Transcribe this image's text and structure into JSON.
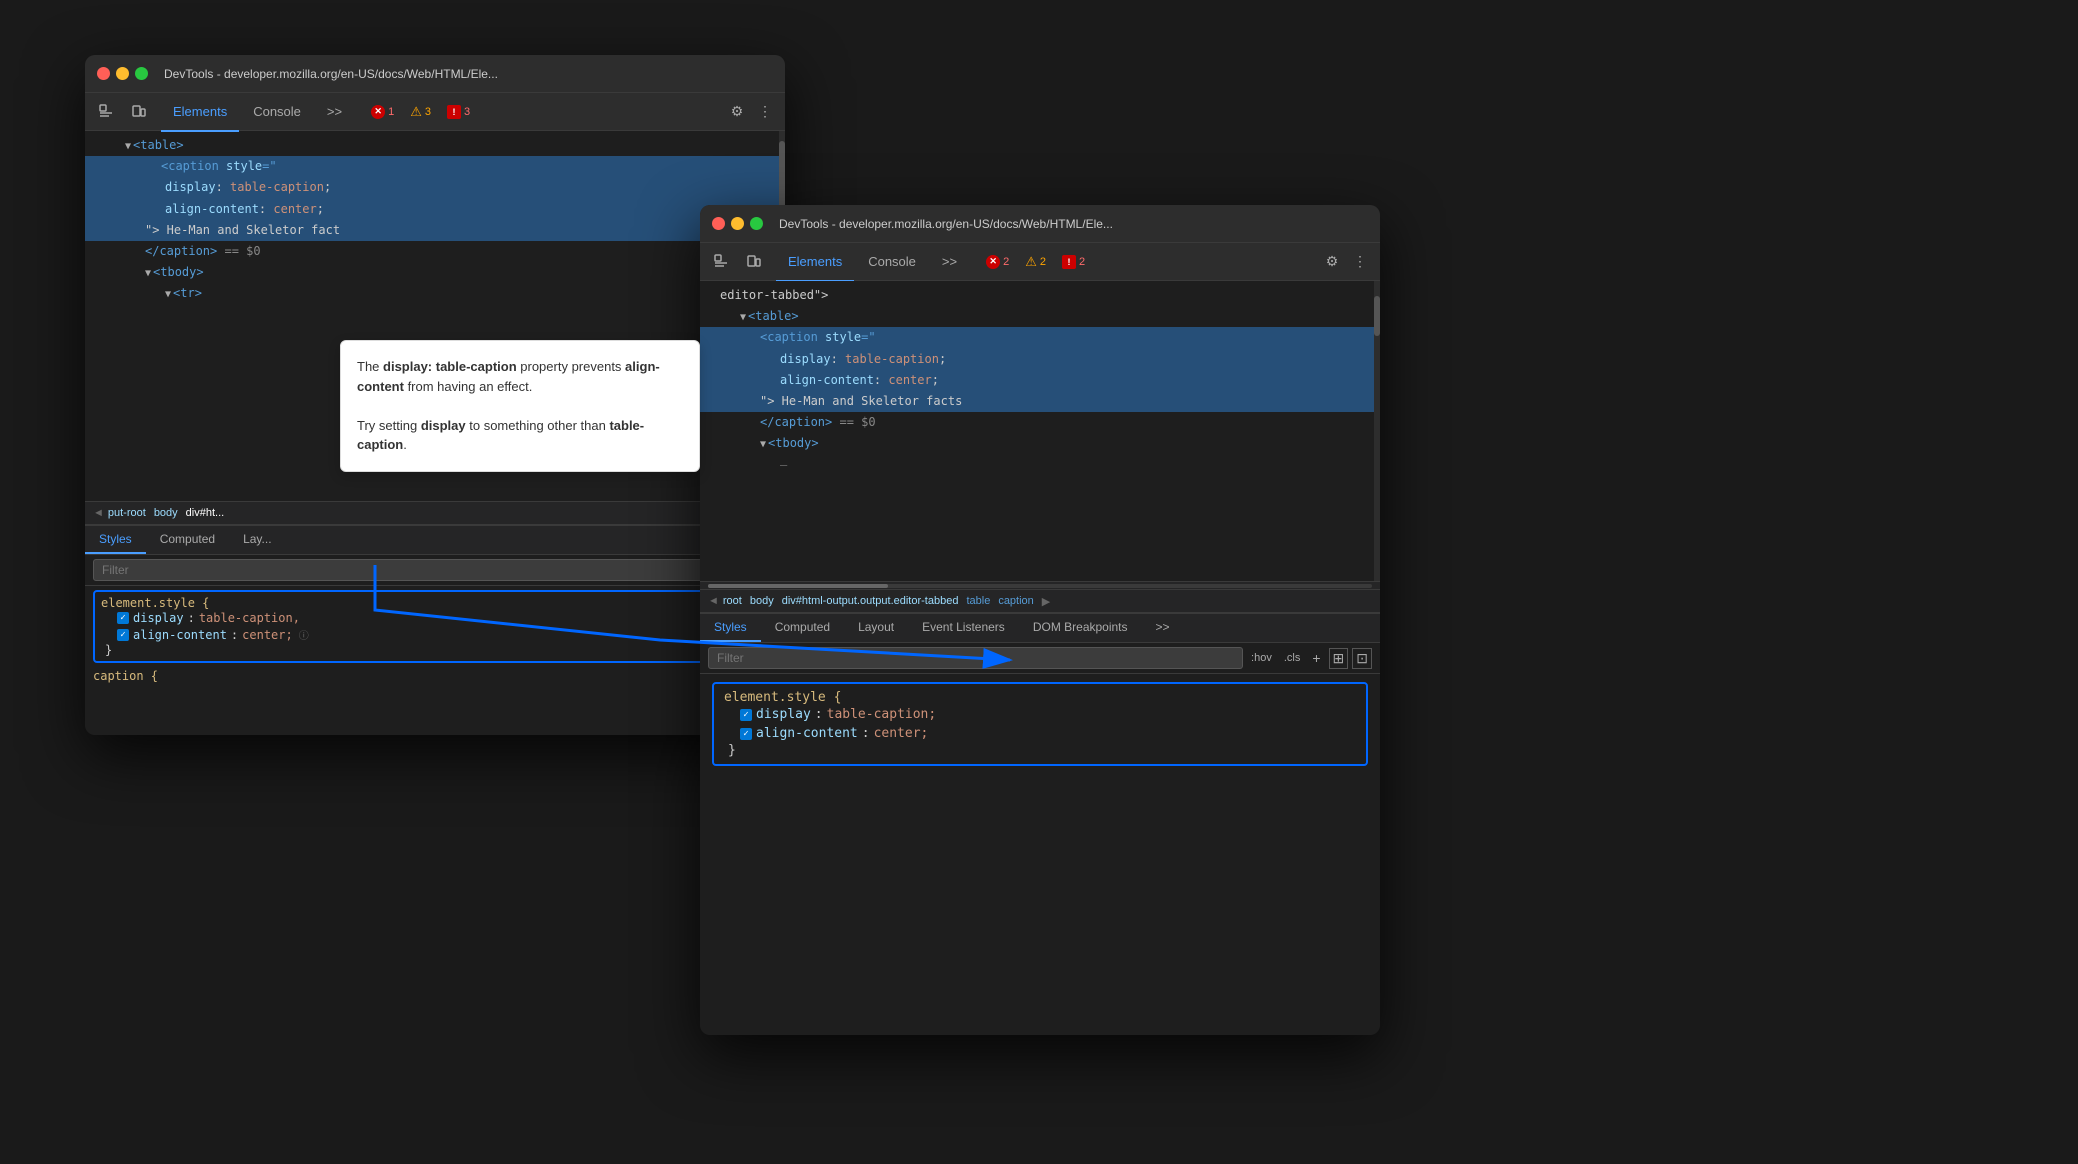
{
  "window1": {
    "title": "DevTools - developer.mozilla.org/en-US/docs/Web/HTML/Ele...",
    "tabs": {
      "elements": "Elements",
      "console": "Console",
      "more": ">>"
    },
    "badges": {
      "error": {
        "icon": "✕",
        "count": "1"
      },
      "warning": {
        "icon": "⚠",
        "count": "3"
      },
      "info": {
        "icon": "!",
        "count": "3"
      }
    },
    "html_lines": [
      {
        "text": "▼ <table>",
        "indent": 2,
        "selected": false
      },
      {
        "text": "<caption style=\"",
        "indent": 3,
        "selected": true
      },
      {
        "text": "display: table-caption;",
        "indent": 4,
        "selected": false
      },
      {
        "text": "align-content: center;",
        "indent": 4,
        "selected": false
      },
      {
        "text": "\"> He-Man and Skeletor fact",
        "indent": 3,
        "selected": false
      },
      {
        "text": "</caption> == $0",
        "indent": 3,
        "selected": false
      },
      {
        "text": "▼ <tbody>",
        "indent": 3,
        "selected": false
      },
      {
        "text": "▼ <tr>",
        "indent": 4,
        "selected": false
      }
    ],
    "breadcrumb": {
      "arrow": "◄",
      "items": [
        "put-root",
        "body",
        "div#ht..."
      ]
    },
    "styles_tabs": [
      "Styles",
      "Computed",
      "Lay..."
    ],
    "filter_placeholder": "Filter",
    "css_rule": {
      "selector": "element.style {",
      "properties": [
        {
          "name": "display",
          "value": "table-caption,"
        },
        {
          "name": "align-content",
          "value": "center;"
        }
      ],
      "close": "}"
    },
    "caption_rule": "caption {"
  },
  "window2": {
    "title": "DevTools - developer.mozilla.org/en-US/docs/Web/HTML/Ele...",
    "tabs": {
      "elements": "Elements",
      "console": "Console",
      "more": ">>"
    },
    "badges": {
      "error": {
        "icon": "✕",
        "count": "2"
      },
      "warning": {
        "icon": "⚠",
        "count": "2"
      },
      "info": {
        "icon": "!",
        "count": "2"
      }
    },
    "html_lines": [
      {
        "text": "editor-tabbed\">",
        "indent": 1
      },
      {
        "text": "▼ <table>",
        "indent": 2
      },
      {
        "text": "<caption style=\"",
        "indent": 3
      },
      {
        "text": "display: table-caption;",
        "indent": 4
      },
      {
        "text": "align-content: center;",
        "indent": 4
      },
      {
        "text": "\"> He-Man and Skeletor facts",
        "indent": 3
      },
      {
        "text": "</caption> == $0",
        "indent": 3
      },
      {
        "text": "▼ <tbody>",
        "indent": 3
      },
      {
        "text": "—",
        "indent": 4
      }
    ],
    "scrollbar_indicator": "────────────────────────────────────",
    "breadcrumb": {
      "arrow": "◄",
      "items": [
        "root",
        "body",
        "div#html-output.output.editor-tabbed",
        "table",
        "caption"
      ]
    },
    "styles_tabs": [
      "Styles",
      "Computed",
      "Layout",
      "Event Listeners",
      "DOM Breakpoints",
      ">>"
    ],
    "filter_placeholder": "Filter",
    "filter_toolbar": [
      ":hov",
      ".cls",
      "+",
      "⊞",
      "⊡"
    ],
    "css_rule": {
      "selector": "element.style {",
      "properties": [
        {
          "name": "display",
          "value": "table-caption;"
        },
        {
          "name": "align-content",
          "value": "center;"
        }
      ],
      "close": "}"
    }
  },
  "tooltip": {
    "line1_prefix": "The ",
    "line1_bold1": "display: table-caption",
    "line1_suffix": " property",
    "line2": "prevents ",
    "line2_bold": "align-content",
    "line2_suffix": " from having an",
    "line3": "effect.",
    "line4": "",
    "line5_prefix": "Try setting ",
    "line5_bold": "display",
    "line5_suffix": " to something other than",
    "line6_bold": "table-caption",
    "line6_suffix": ".",
    "full_text1": "The display: table-caption property prevents align-content from having an effect.",
    "full_text2": "Try setting display to something other than table-caption."
  },
  "icons": {
    "inspect": "⬚",
    "device": "⬜",
    "gear": "⚙",
    "more": "⋮"
  }
}
